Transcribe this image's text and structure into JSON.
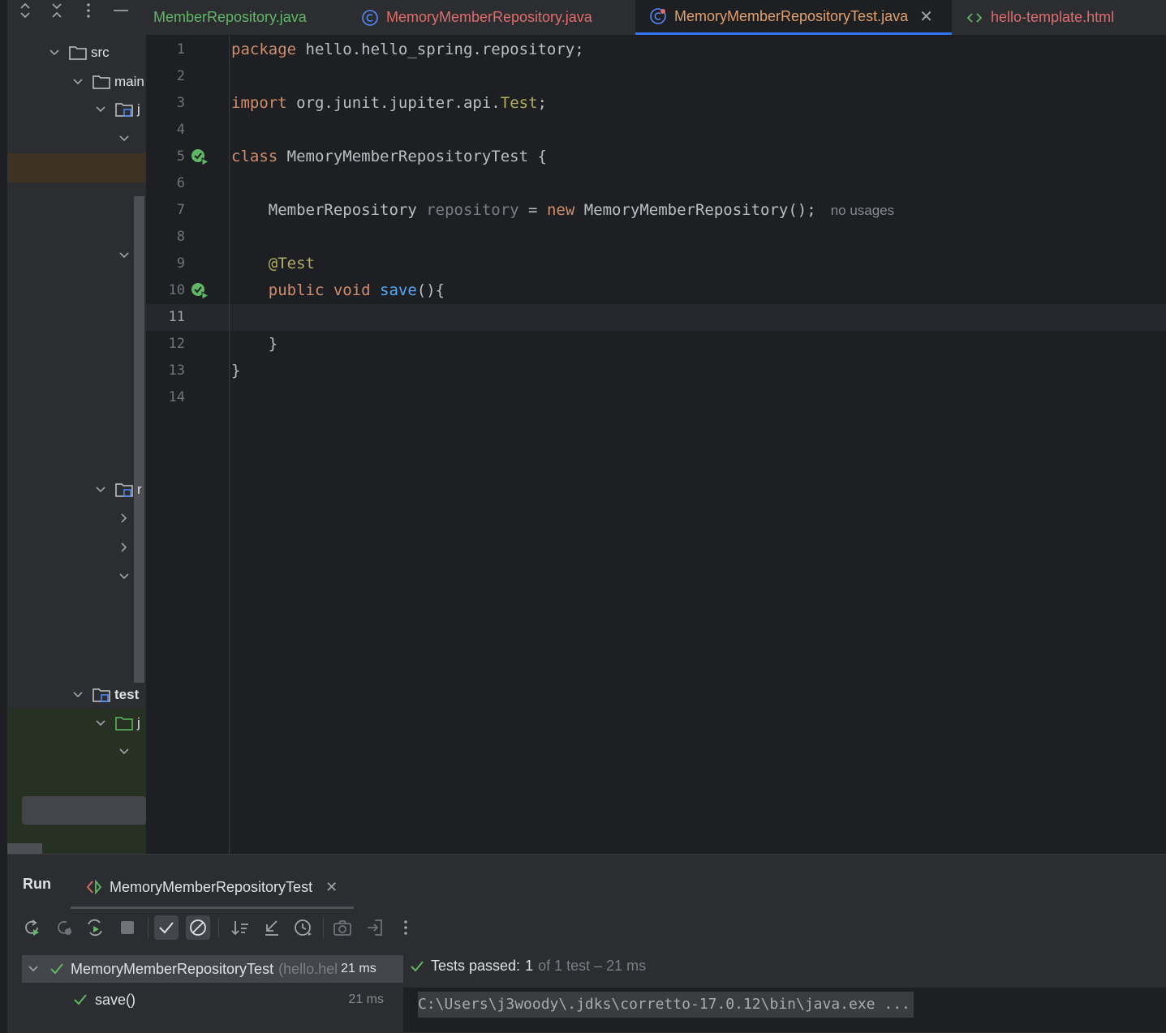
{
  "tabs": [
    {
      "label": "MemberRepository.java",
      "color": "#5fb865",
      "icon": "interface-icon"
    },
    {
      "label": "MemoryMemberRepository.java",
      "color": "#e06c6c",
      "icon": "class-icon"
    },
    {
      "label": "MemoryMemberRepositoryTest.java",
      "color": "#e0a070",
      "icon": "test-class-icon",
      "active": true
    },
    {
      "label": "hello-template.html",
      "color": "#e06c6c",
      "icon": "html-icon"
    }
  ],
  "project_tree": {
    "items": [
      {
        "label": "src"
      },
      {
        "label": "main"
      },
      {
        "label": "j"
      },
      {
        "label": "r"
      },
      {
        "label": "test"
      },
      {
        "label": "j"
      }
    ]
  },
  "editor": {
    "line_numbers": [
      "1",
      "2",
      "3",
      "4",
      "5",
      "6",
      "7",
      "8",
      "9",
      "10",
      "11",
      "12",
      "13",
      "14"
    ],
    "code": {
      "l1_kw": "package",
      "l1_rest": " hello.hello_spring.repository;",
      "l3_kw": "import",
      "l3_rest": " org.junit.jupiter.api.",
      "l3_ann": "Test",
      "l3_end": ";",
      "l5_kw": "class",
      "l5_rest": " MemoryMemberRepositoryTest {",
      "l7_type": "    MemberRepository ",
      "l7_var": "repository",
      "l7_eq": " = ",
      "l7_new": "new",
      "l7_rest": " MemoryMemberRepository();",
      "l7_hint": "no usages",
      "l9_ann": "    @Test",
      "l10_kw": "    public void ",
      "l10_fn": "save",
      "l10_rest": "(){",
      "l12": "    }",
      "l13": "}"
    }
  },
  "run_panel": {
    "title": "Run",
    "config_tab": "MemoryMemberRepositoryTest",
    "tree": {
      "root_label": "MemoryMemberRepositoryTest",
      "root_package": "(hello.hel",
      "root_time": "21 ms",
      "child_label": "save()",
      "child_time": "21 ms"
    },
    "status_prefix": "Tests passed:",
    "status_count": "1",
    "status_suffix": "of 1 test – 21 ms",
    "console_line": "C:\\Users\\j3woody\\.jdks\\corretto-17.0.12\\bin\\java.exe ..."
  },
  "colors": {
    "accent": "#3574f0",
    "pass_green": "#5fb865",
    "keyword": "#cf8e6d",
    "function": "#56a8f5",
    "annotation": "#b3ae60"
  }
}
